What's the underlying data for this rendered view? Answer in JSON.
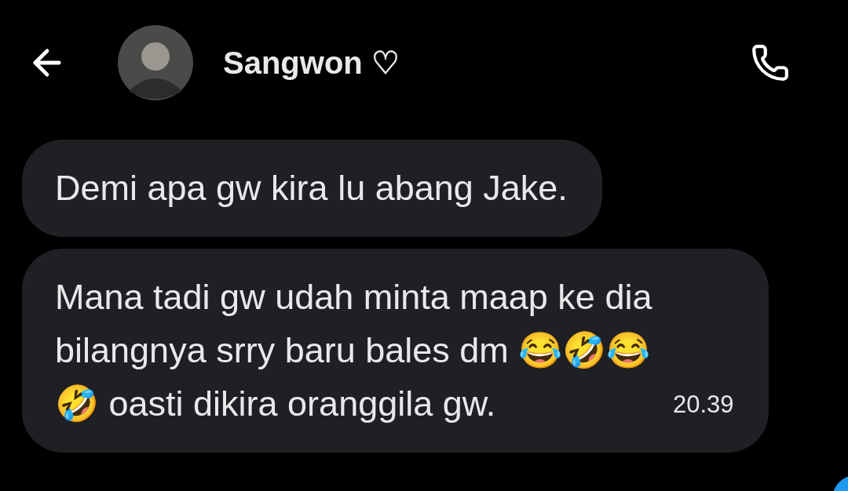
{
  "header": {
    "name": "Sangwon ♡"
  },
  "messages": [
    {
      "text": "Demi apa gw kira lu abang Jake."
    },
    {
      "text": "Mana tadi gw udah minta maap ke dia bilangnya srry baru bales dm 😂🤣😂 🤣 oasti dikira oranggila gw.",
      "time": "20.39"
    }
  ]
}
